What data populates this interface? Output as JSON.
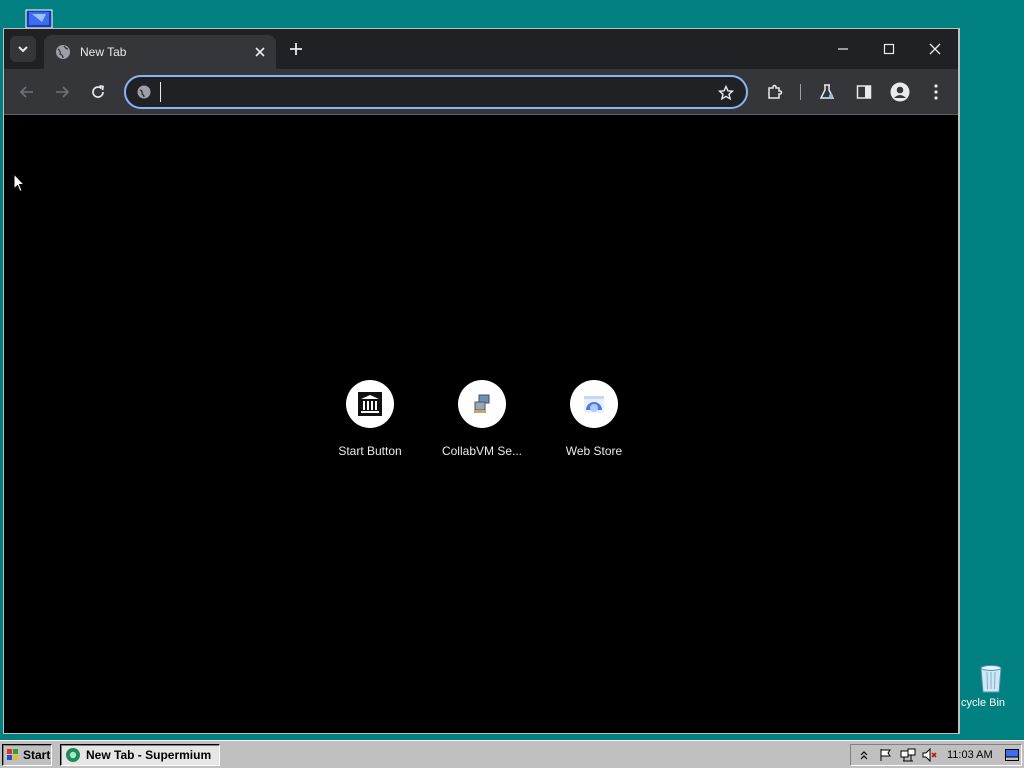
{
  "desktop": {
    "recycle_bin_label": "cycle Bin"
  },
  "browser": {
    "tab": {
      "title": "New Tab"
    },
    "omnibox": {
      "value": "",
      "placeholder": ""
    },
    "accent_color": "#8ab4f8",
    "shortcuts": [
      {
        "label": "Start Button",
        "icon": "museum-icon"
      },
      {
        "label": "CollabVM Se...",
        "icon": "computer-icon"
      },
      {
        "label": "Web Store",
        "icon": "web-store-icon"
      }
    ]
  },
  "taskbar": {
    "start_label": "Start",
    "task_label": "New Tab - Supermium",
    "clock": "11:03 AM"
  }
}
